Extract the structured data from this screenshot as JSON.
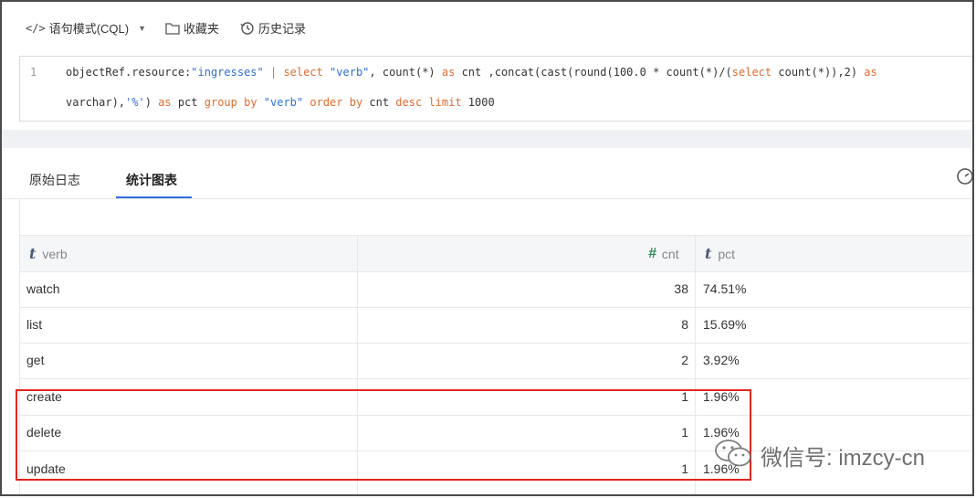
{
  "toolbar": {
    "mode_label": "语句模式(CQL)",
    "favorites_label": "收藏夹",
    "history_label": "历史记录"
  },
  "editor": {
    "line_number": "1",
    "line1": {
      "t1": "objectRef.resource:",
      "t2": "\"ingresses\"",
      "t3": " | ",
      "t4": "select",
      "t5": " ",
      "t6": "\"verb\"",
      "t7": ", count(*) ",
      "t8": "as",
      "t9": " cnt ,concat(cast(round(100.0 * count(*)/(",
      "t10": "select",
      "t11": " count(*)),2) ",
      "t12": "as"
    },
    "line2": {
      "t1": "varchar),",
      "t2": "'%'",
      "t3": ") ",
      "t4": "as",
      "t5": " pct ",
      "t6": "group by",
      "t7": " ",
      "t8": "\"verb\"",
      "t9": " ",
      "t10": "order by",
      "t11": " cnt ",
      "t12": "desc",
      "t13": " ",
      "t14": "limit",
      "t15": " 1000"
    }
  },
  "tabs": [
    {
      "label": "原始日志"
    },
    {
      "label": "统计图表"
    }
  ],
  "table": {
    "columns": [
      {
        "icon": "t",
        "label": "verb"
      },
      {
        "icon": "#",
        "label": "cnt"
      },
      {
        "icon": "t",
        "label": "pct"
      }
    ],
    "rows": [
      {
        "verb": "watch",
        "cnt": "38",
        "pct": "74.51%"
      },
      {
        "verb": "list",
        "cnt": "8",
        "pct": "15.69%"
      },
      {
        "verb": "get",
        "cnt": "2",
        "pct": "3.92%"
      },
      {
        "verb": "create",
        "cnt": "1",
        "pct": "1.96%"
      },
      {
        "verb": "delete",
        "cnt": "1",
        "pct": "1.96%"
      },
      {
        "verb": "update",
        "cnt": "1",
        "pct": "1.96%"
      }
    ]
  },
  "watermark": {
    "text": "微信号: imzcy-cn"
  },
  "colors": {
    "keyword": "#e06c2e",
    "string": "#2f6fd6",
    "highlight": "#e3261f",
    "tab_active": "#2f6fd6"
  }
}
